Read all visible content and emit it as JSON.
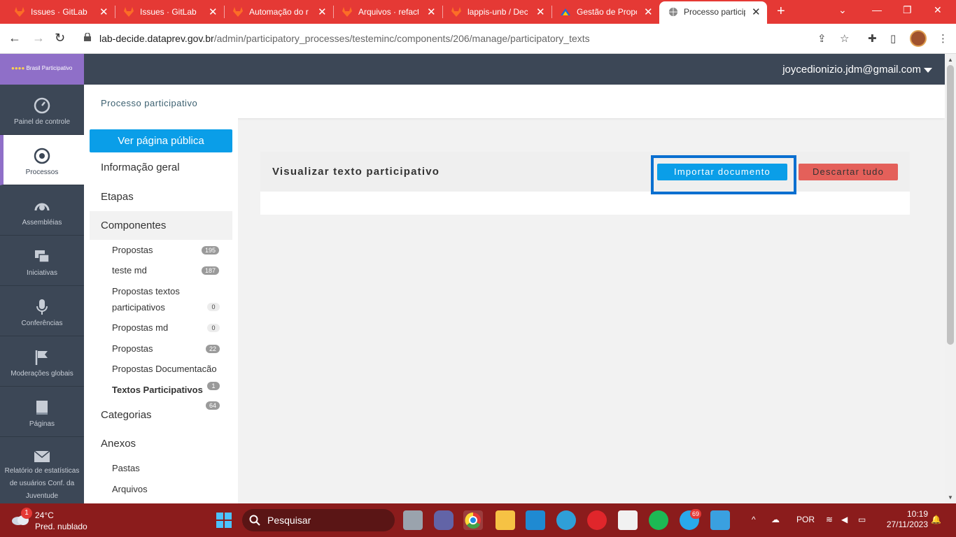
{
  "browser": {
    "tabs": [
      {
        "label": "Issues · GitLab",
        "icon": "gitlab-icon"
      },
      {
        "label": "Issues · GitLab",
        "icon": "gitlab-icon"
      },
      {
        "label": "Automação do r",
        "icon": "gitlab-icon"
      },
      {
        "label": "Arquivos · refact",
        "icon": "gitlab-icon"
      },
      {
        "label": "lappis-unb / Dec",
        "icon": "gitlab-icon"
      },
      {
        "label": "Gestão de Propo",
        "icon": "gov-icon"
      },
      {
        "label": "Processo particip",
        "icon": "globe-icon",
        "active": true
      }
    ],
    "url_host": "lab-decide.dataprev.gov.br",
    "url_path": "/admin/participatory_processes/testeminc/components/206/manage/participatory_texts"
  },
  "app": {
    "logo_text": "Brasil Participativo",
    "user_email": "joycedionizio.jdm@gmail.com",
    "page_title": "Processo participativo",
    "main_nav": [
      {
        "label": "Painel de controle",
        "icon": "dashboard-icon"
      },
      {
        "label": "Processos",
        "icon": "target-icon",
        "active": true
      },
      {
        "label": "Assembléias",
        "icon": "assembly-icon"
      },
      {
        "label": "Iniciativas",
        "icon": "chat-icon"
      },
      {
        "label": "Conferências",
        "icon": "microphone-icon"
      },
      {
        "label": "Moderações globais",
        "icon": "flag-icon"
      },
      {
        "label": "Páginas",
        "icon": "book-icon"
      },
      {
        "label": "Relatório de estatísticas de usuários Conf. da Juventude",
        "icon": "mail-icon"
      }
    ],
    "public_button": "Ver página pública",
    "sections": {
      "info": "Informação geral",
      "steps": "Etapas",
      "components": "Componentes",
      "categories": "Categorias",
      "attachments": "Anexos"
    },
    "components": [
      {
        "label": "Propostas",
        "count": "195"
      },
      {
        "label": "teste md",
        "count": "187"
      },
      {
        "label": "Propostas textos participativos",
        "count": "0"
      },
      {
        "label": "Propostas md",
        "count": "0"
      },
      {
        "label": "Propostas",
        "count": "22"
      },
      {
        "label": "Propostas Documentacão",
        "count": ""
      },
      {
        "label": "Textos Participativos",
        "count": "1"
      }
    ],
    "categories_count": "64",
    "attachment_items": [
      "Pastas",
      "Arquivos"
    ],
    "panel": {
      "title": "Visualizar texto participativo",
      "import_button": "Importar documento",
      "discard_button": "Descartar tudo"
    }
  },
  "taskbar": {
    "weather_badge": "1",
    "temperature": "24°C",
    "weather_desc": "Pred. nublado",
    "search_placeholder": "Pesquisar",
    "telegram_badge": "69",
    "language": "POR",
    "time": "10:19",
    "date": "27/11/2023"
  }
}
